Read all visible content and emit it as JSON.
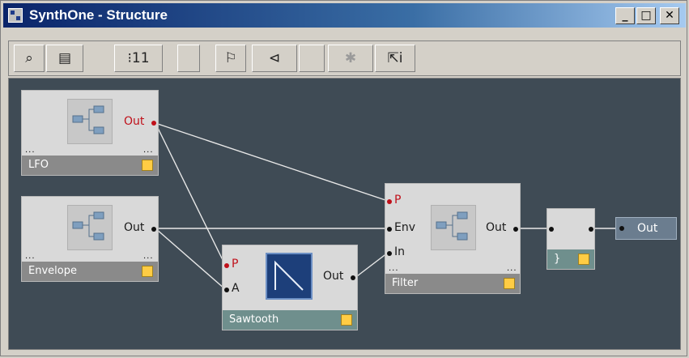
{
  "window": {
    "title": "SynthOne - Structure",
    "controls": [
      "_",
      "□",
      "✕"
    ]
  },
  "toolbar": {
    "buttons": [
      {
        "name": "zoom-fit-button",
        "glyph": "⌕",
        "enabled": true
      },
      {
        "name": "overview-button",
        "glyph": "▤",
        "enabled": true
      },
      {
        "name": "numeric-view-button",
        "glyph": "⁝11",
        "enabled": true
      },
      {
        "name": "flag-button",
        "glyph": "⚐",
        "enabled": true
      },
      {
        "name": "route-button",
        "glyph": "⊲",
        "enabled": true
      },
      {
        "name": "debug-button",
        "glyph": "✱",
        "enabled": false
      },
      {
        "name": "info-cursor-button",
        "glyph": "⇱i",
        "enabled": true
      }
    ]
  },
  "modules": {
    "lfo": {
      "name": "LFO",
      "out": "Out"
    },
    "envelope": {
      "name": "Envelope",
      "out": "Out"
    },
    "sawtooth": {
      "name": "Sawtooth",
      "in_p": "P",
      "in_a": "A",
      "out": "Out"
    },
    "filter": {
      "name": "Filter",
      "in_p": "P",
      "in_env": "Env",
      "in_in": "In",
      "out": "Out"
    },
    "scope": {
      "name": "}"
    },
    "output": {
      "label": "Out"
    }
  },
  "colors": {
    "canvas": "#3f4b55",
    "wire": "#e8e8e8",
    "accent_red": "#c0101a",
    "led": "#ffcc44",
    "title_gradient_start": "#0a246a"
  },
  "ellipsis": "..."
}
